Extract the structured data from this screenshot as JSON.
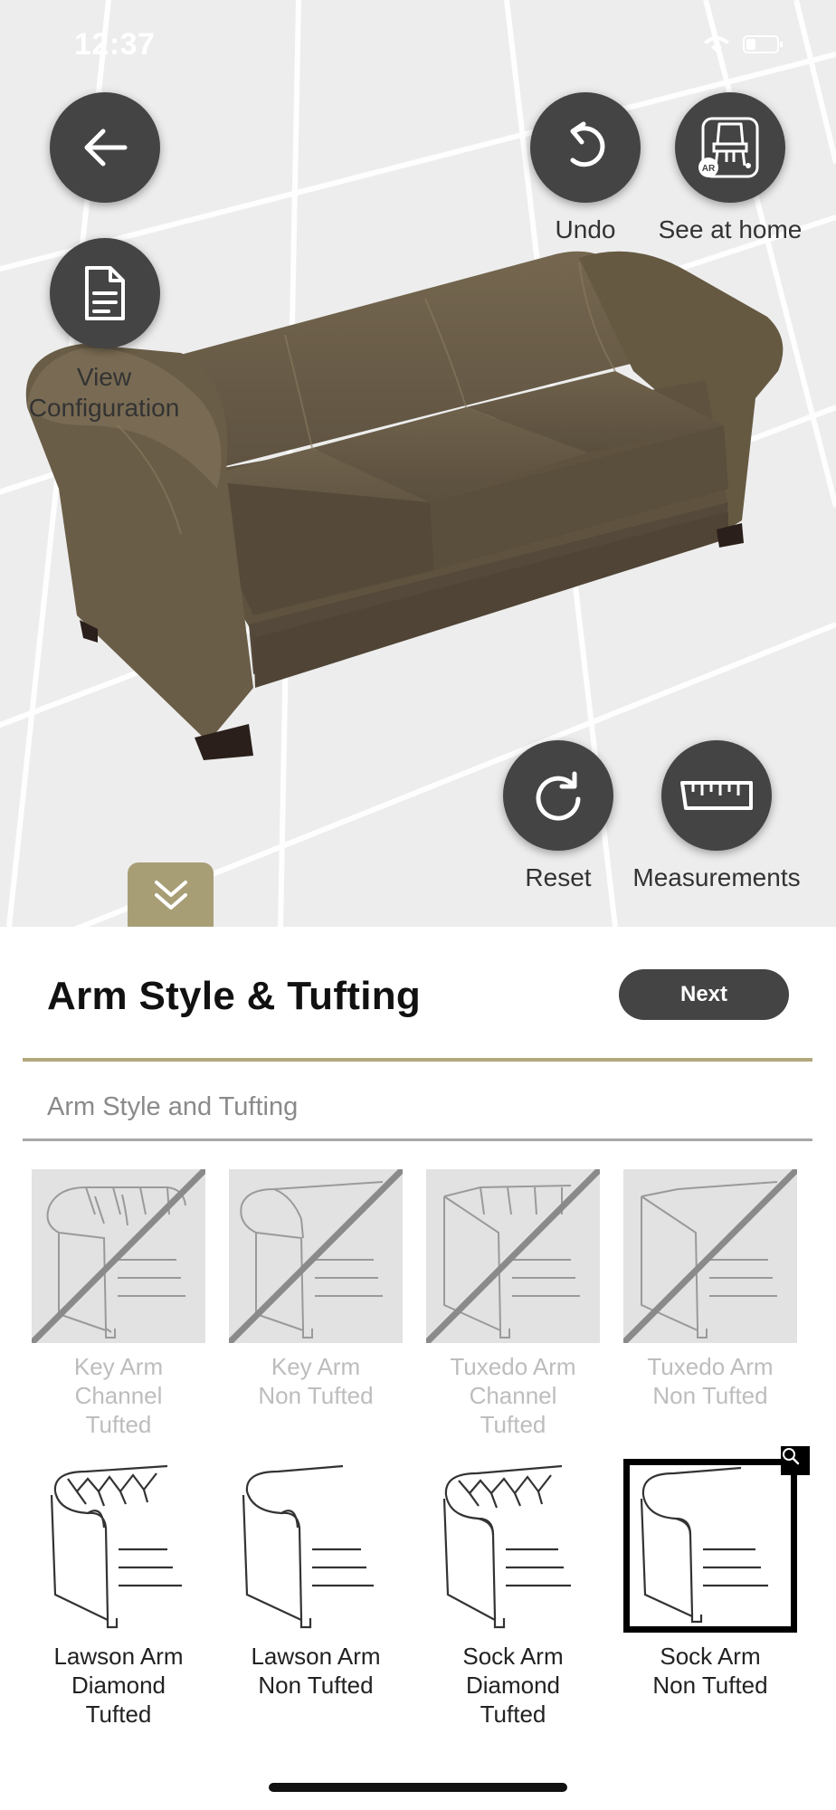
{
  "status_bar": {
    "time": "12:37"
  },
  "viewer": {
    "back_icon": "arrow-left-icon",
    "view_config_label": "View\nConfiguration",
    "undo_label": "Undo",
    "see_at_home_label": "See at home",
    "ar_badge": "AR",
    "reset_label": "Reset",
    "measurements_label": "Measurements",
    "collapse_icon": "double-chevron-down-icon"
  },
  "panel": {
    "title": "Arm Style & Tufting",
    "next_label": "Next",
    "section_label": "Arm Style and Tufting",
    "accent_color": "#b3a77e",
    "options": [
      {
        "label": "Key Arm\nChannel\nTufted",
        "enabled": false
      },
      {
        "label": "Key Arm\nNon Tufted",
        "enabled": false
      },
      {
        "label": "Tuxedo Arm\nChannel\nTufted",
        "enabled": false
      },
      {
        "label": "Tuxedo Arm\nNon Tufted",
        "enabled": false
      },
      {
        "label": "Lawson Arm\nDiamond\nTufted",
        "enabled": true
      },
      {
        "label": "Lawson Arm\nNon Tufted",
        "enabled": true
      },
      {
        "label": "Sock Arm\nDiamond\nTufted",
        "enabled": true
      },
      {
        "label": "Sock Arm\nNon Tufted",
        "enabled": true,
        "selected": true
      }
    ]
  }
}
